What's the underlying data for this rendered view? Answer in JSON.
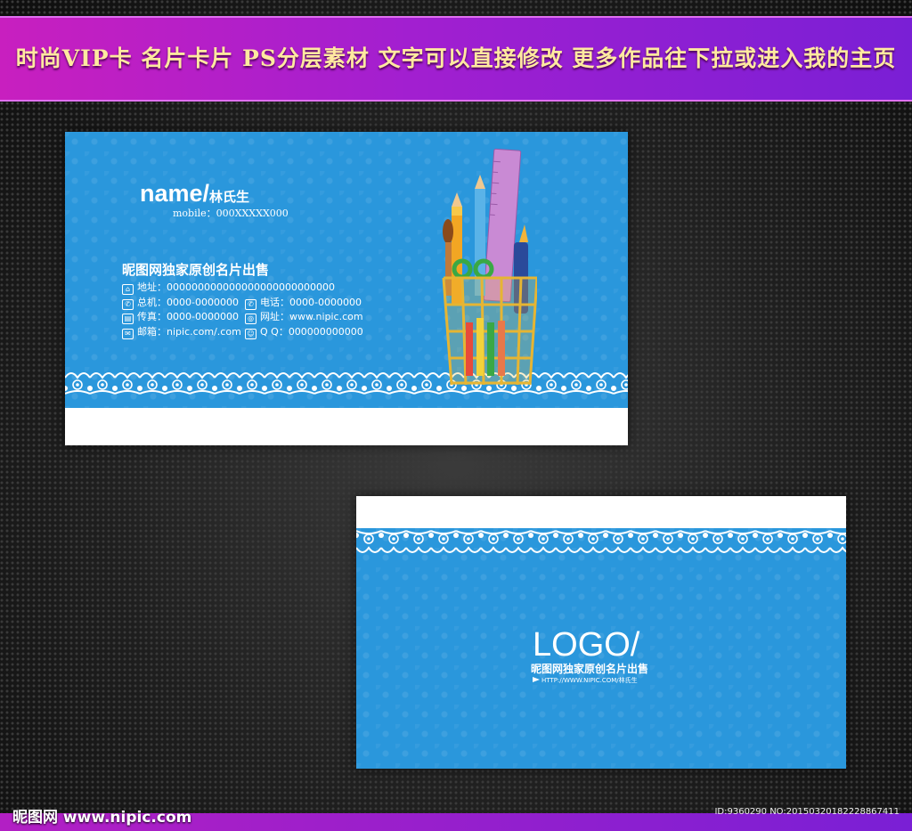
{
  "banner": {
    "text": "时尚VIP卡 名片卡片 PS分层素材 文字可以直接修改 更多作品往下拉或进入我的主页"
  },
  "front_card": {
    "name": "name/",
    "name_cn": "林氏生",
    "mobile": "mobile：000XXXXX000",
    "company": "昵图网独家原创名片出售",
    "address": "地址：000000000000000000000000000",
    "phone": "总机：0000-0000000",
    "tel": "电话：0000-0000000",
    "fax": "传真：0000-0000000",
    "website": "网址：www.nipic.com",
    "email": "邮箱：nipic.com/.com",
    "qq": "Q Q：000000000000"
  },
  "back_card": {
    "logo": "LOGO/",
    "company": "昵图网独家原创名片出售",
    "url": "HTTP://WWW.NIPIC.COM/林氏生"
  },
  "watermark": {
    "text": "昵图网 www.nipic.com"
  },
  "id_text": "ID:9360290 NO:20150320182228867411",
  "colors": {
    "card_blue": "#2a97dc",
    "banner_purple": "#b21fc4",
    "banner_text_gold": "#ffe9a0"
  },
  "icons": [
    "home-icon",
    "phone-icon",
    "fax-icon",
    "mail-icon",
    "globe-icon",
    "qq-icon"
  ]
}
